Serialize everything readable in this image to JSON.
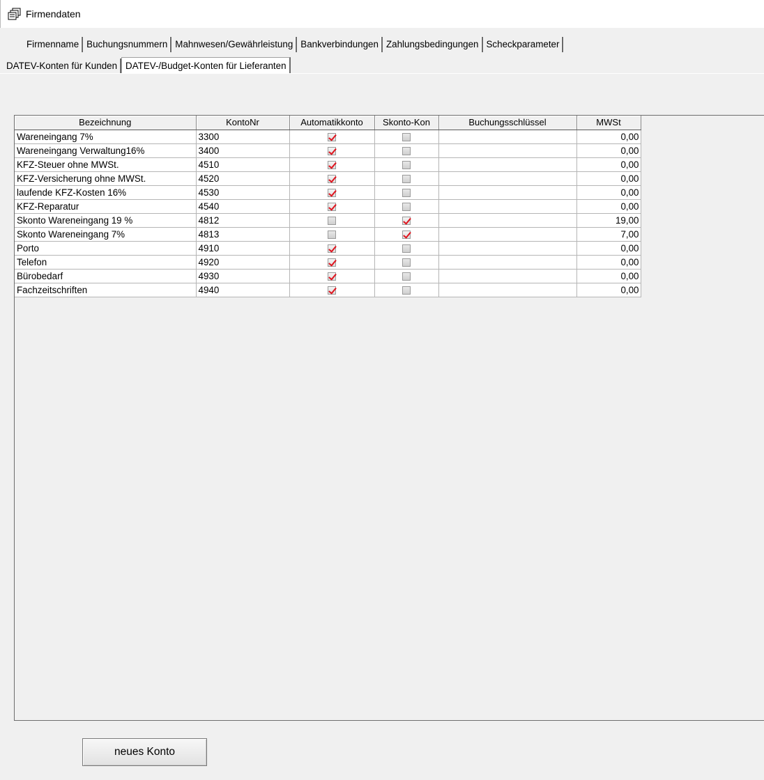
{
  "window": {
    "title": "Firmendaten",
    "icon": "documents-icon"
  },
  "tabs_row1": [
    {
      "label": "Firmenname"
    },
    {
      "label": "Buchungsnummern"
    },
    {
      "label": "Mahnwesen/Gewährleistung"
    },
    {
      "label": "Bankverbindungen"
    },
    {
      "label": "Zahlungsbedingungen"
    },
    {
      "label": "Scheckparameter"
    }
  ],
  "tabs_row2": [
    {
      "label": "DATEV-Konten für Kunden",
      "active": false
    },
    {
      "label": "DATEV-/Budget-Konten für Lieferanten",
      "active": true
    }
  ],
  "grid": {
    "columns": [
      "Bezeichnung",
      "KontoNr",
      "Automatikkonto",
      "Skonto-Kon",
      "Buchungsschlüssel",
      "MWSt"
    ],
    "rows": [
      {
        "bezeichnung": "Wareneingang 7%",
        "kontonr": "3300",
        "automatik": true,
        "skonto": false,
        "schluessel": "",
        "mwst": "0,00"
      },
      {
        "bezeichnung": "Wareneingang Verwaltung16%",
        "kontonr": "3400",
        "automatik": true,
        "skonto": false,
        "schluessel": "",
        "mwst": "0,00"
      },
      {
        "bezeichnung": "KFZ-Steuer ohne MWSt.",
        "kontonr": "4510",
        "automatik": true,
        "skonto": false,
        "schluessel": "",
        "mwst": "0,00"
      },
      {
        "bezeichnung": "KFZ-Versicherung ohne MWSt.",
        "kontonr": "4520",
        "automatik": true,
        "skonto": false,
        "schluessel": "",
        "mwst": "0,00"
      },
      {
        "bezeichnung": "laufende KFZ-Kosten 16%",
        "kontonr": "4530",
        "automatik": true,
        "skonto": false,
        "schluessel": "",
        "mwst": "0,00"
      },
      {
        "bezeichnung": "KFZ-Reparatur",
        "kontonr": "4540",
        "automatik": true,
        "skonto": false,
        "schluessel": "",
        "mwst": "0,00"
      },
      {
        "bezeichnung": "Skonto Wareneingang 19 %",
        "kontonr": "4812",
        "automatik": false,
        "skonto": true,
        "schluessel": "",
        "mwst": "19,00"
      },
      {
        "bezeichnung": "Skonto Wareneingang 7%",
        "kontonr": "4813",
        "automatik": false,
        "skonto": true,
        "schluessel": "",
        "mwst": "7,00"
      },
      {
        "bezeichnung": "Porto",
        "kontonr": "4910",
        "automatik": true,
        "skonto": false,
        "schluessel": "",
        "mwst": "0,00"
      },
      {
        "bezeichnung": "Telefon",
        "kontonr": "4920",
        "automatik": true,
        "skonto": false,
        "schluessel": "",
        "mwst": "0,00"
      },
      {
        "bezeichnung": "Bürobedarf",
        "kontonr": "4930",
        "automatik": true,
        "skonto": false,
        "schluessel": "",
        "mwst": "0,00"
      },
      {
        "bezeichnung": "Fachzeitschriften",
        "kontonr": "4940",
        "automatik": true,
        "skonto": false,
        "schluessel": "",
        "mwst": "0,00"
      }
    ],
    "checkmark_color": "#e0141e"
  },
  "actions": {
    "new_account_label": "neues Konto"
  }
}
